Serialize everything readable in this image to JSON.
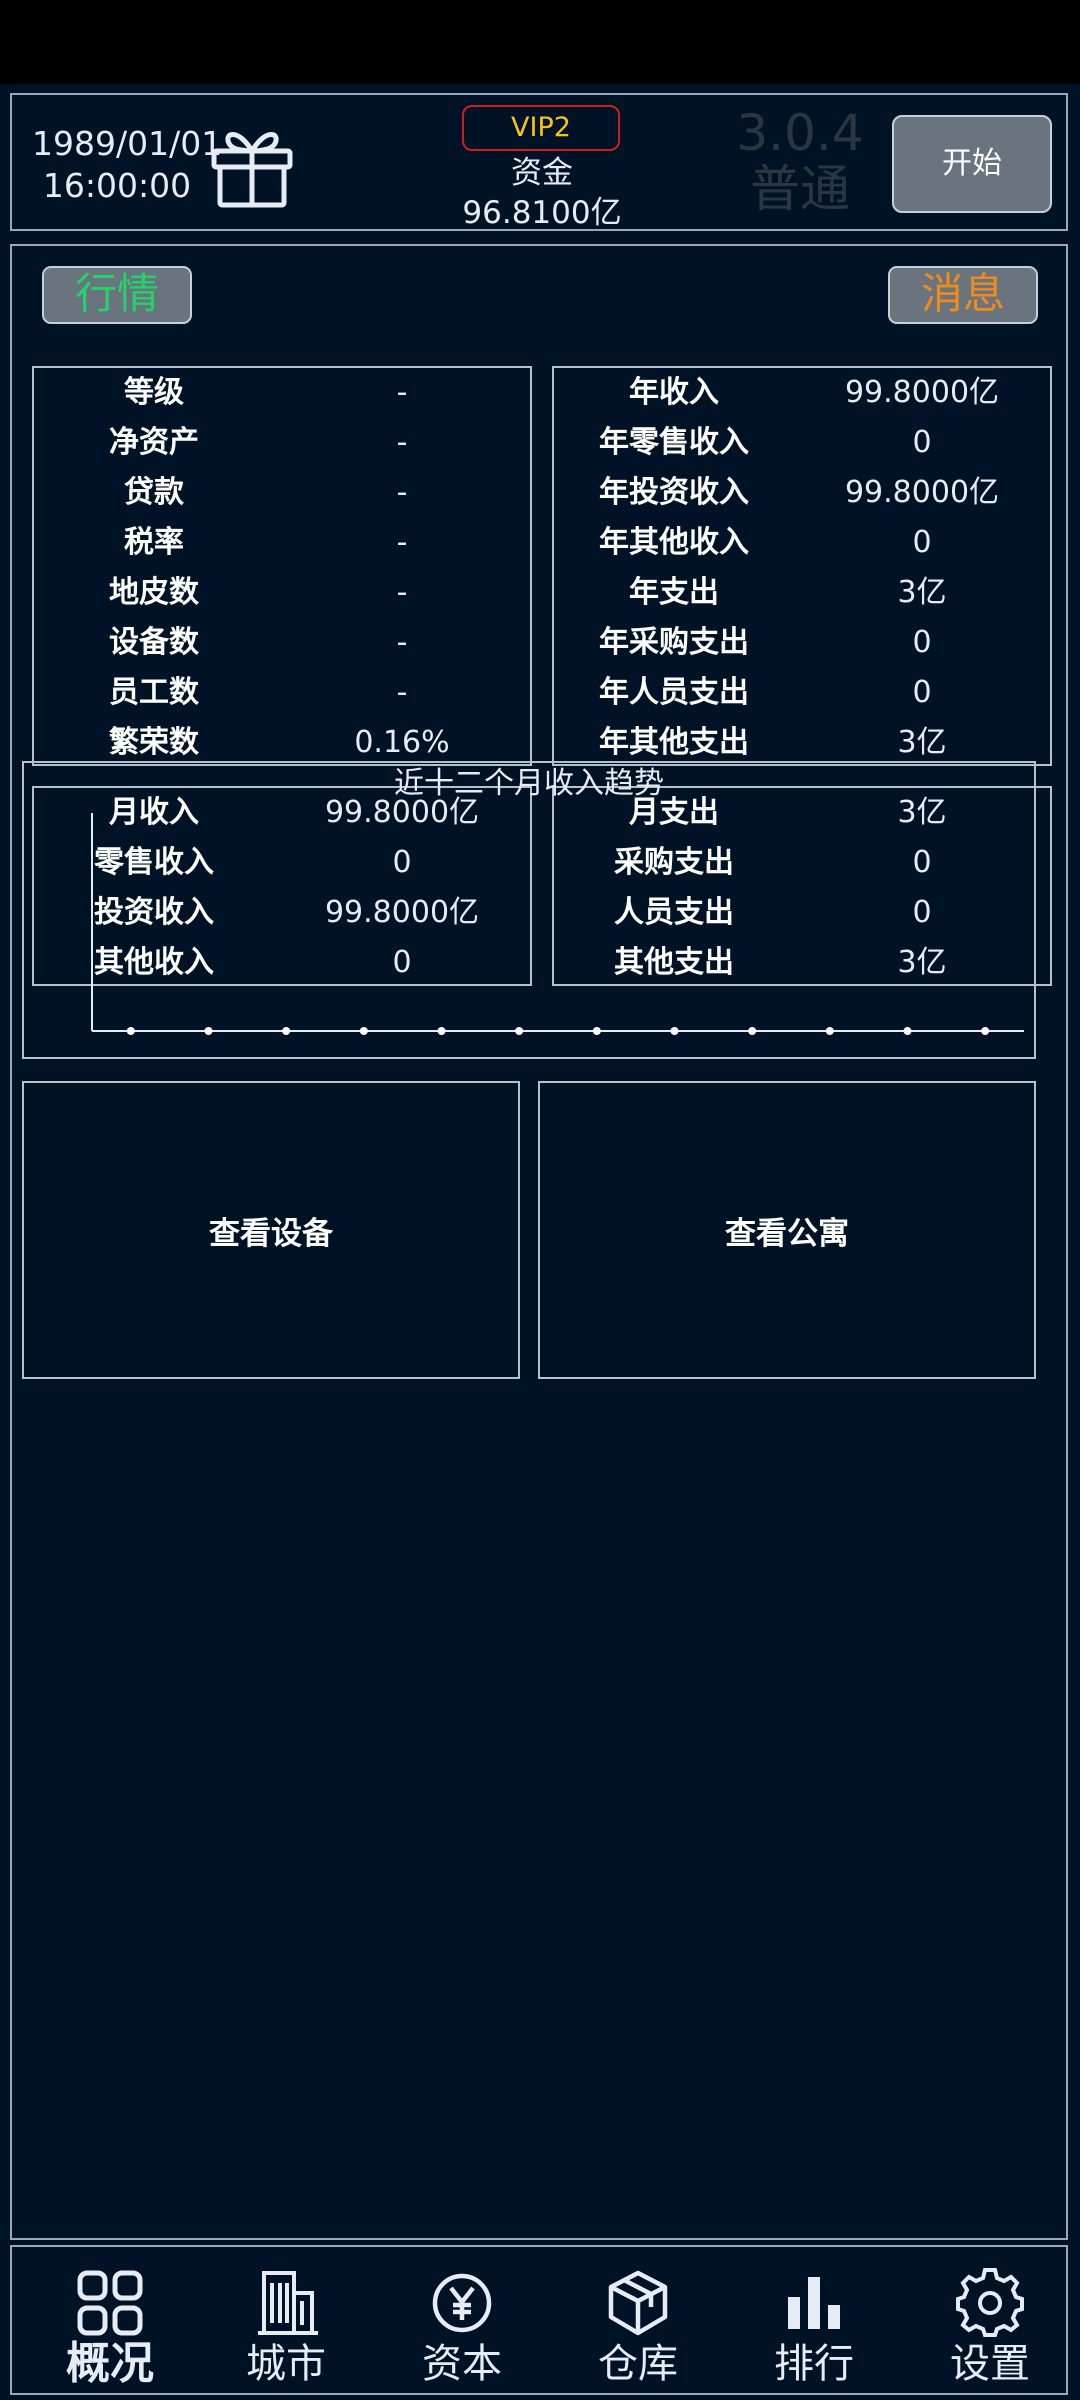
{
  "header": {
    "date": "1989/01/01",
    "time": "16:00:00",
    "vip": "VIP2",
    "funds_label": "资金",
    "funds_value": "96.8100亿",
    "version": "3.0.4",
    "mode": "普通",
    "start_label": "开始"
  },
  "tabs": {
    "market": "行情",
    "news": "消息"
  },
  "stats_left": [
    {
      "label": "等级",
      "value": "-"
    },
    {
      "label": "净资产",
      "value": "-"
    },
    {
      "label": "贷款",
      "value": "-"
    },
    {
      "label": "税率",
      "value": "-"
    },
    {
      "label": "地皮数",
      "value": "-"
    },
    {
      "label": "设备数",
      "value": "-"
    },
    {
      "label": "员工数",
      "value": "-"
    },
    {
      "label": "繁荣数",
      "value": "0.16%"
    }
  ],
  "stats_right": [
    {
      "label": "年收入",
      "value": "99.8000亿"
    },
    {
      "label": "年零售收入",
      "value": "0"
    },
    {
      "label": "年投资收入",
      "value": "99.8000亿"
    },
    {
      "label": "年其他收入",
      "value": "0"
    },
    {
      "label": "年支出",
      "value": "3亿"
    },
    {
      "label": "年采购支出",
      "value": "0"
    },
    {
      "label": "年人员支出",
      "value": "0"
    },
    {
      "label": "年其他支出",
      "value": "3亿"
    }
  ],
  "monthly_income": [
    {
      "label": "月收入",
      "value": "99.8000亿"
    },
    {
      "label": "零售收入",
      "value": "0"
    },
    {
      "label": "投资收入",
      "value": "99.8000亿"
    },
    {
      "label": "其他收入",
      "value": "0"
    }
  ],
  "monthly_expense": [
    {
      "label": "月支出",
      "value": "3亿"
    },
    {
      "label": "采购支出",
      "value": "0"
    },
    {
      "label": "人员支出",
      "value": "0"
    },
    {
      "label": "其他支出",
      "value": "3亿"
    }
  ],
  "chart": {
    "title": "近十二个月收入趋势"
  },
  "chart_data": {
    "type": "line",
    "title": "近十二个月收入趋势",
    "x": [
      1,
      2,
      3,
      4,
      5,
      6,
      7,
      8,
      9,
      10,
      11,
      12
    ],
    "values": [
      0,
      0,
      0,
      0,
      0,
      0,
      0,
      0,
      0,
      0,
      0,
      0
    ],
    "grid": false
  },
  "actions": {
    "devices": "查看设备",
    "apartments": "查看公寓"
  },
  "nav": [
    {
      "label": "概况",
      "icon": "grid-icon",
      "active": true
    },
    {
      "label": "城市",
      "icon": "building-icon",
      "active": false
    },
    {
      "label": "资本",
      "icon": "yen-coin-icon",
      "active": false
    },
    {
      "label": "仓库",
      "icon": "box-icon",
      "active": false
    },
    {
      "label": "排行",
      "icon": "bar-chart-icon",
      "active": false
    },
    {
      "label": "设置",
      "icon": "gear-icon",
      "active": false
    }
  ],
  "colors": {
    "background": "#001326",
    "market": "#22d36a",
    "news": "#f08a1e",
    "vip_text": "#f3c616",
    "vip_border": "#d11c1c"
  }
}
